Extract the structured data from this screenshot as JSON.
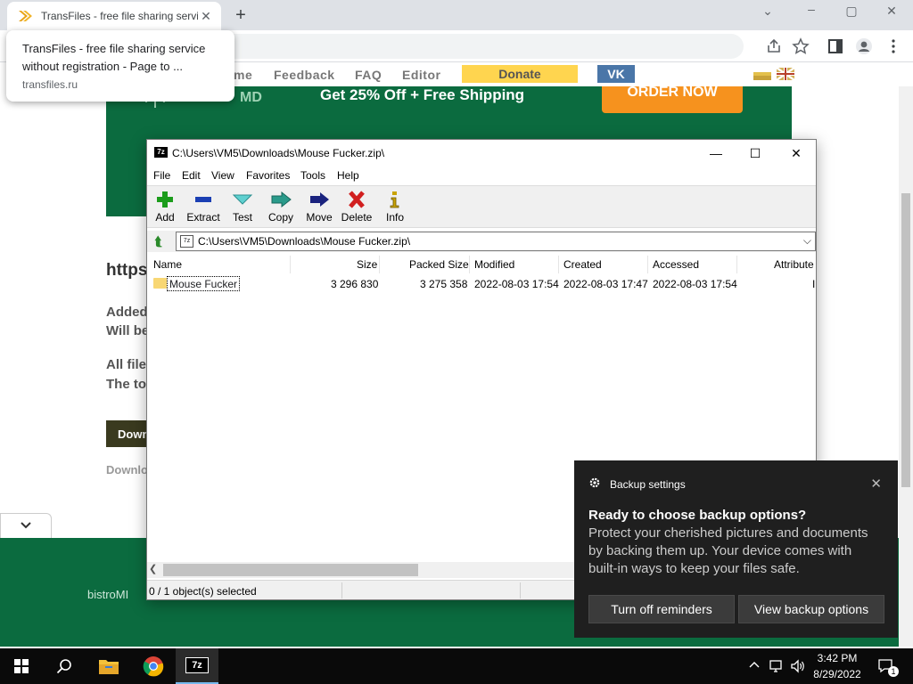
{
  "browser": {
    "tab_title": "TransFiles - free file sharing servi",
    "tab_close": "✕",
    "new_tab": "+",
    "hover_title": "TransFiles - free file sharing service without registration - Page to ...",
    "hover_url": "transfiles.ru",
    "minimize": "⌄",
    "maximize": "▢",
    "close": "✕"
  },
  "site": {
    "nav": [
      "me",
      "Feedback",
      "FAQ",
      "Editor"
    ],
    "donate": "Donate",
    "vk": "VK",
    "ad_logo": "MD",
    "ad_text": "Get 25% Off + Free Shipping",
    "ad_button": "ORDER NOW",
    "heading_fragment": "https",
    "line1": "Added",
    "line2": "Will be",
    "line3": "All file",
    "line4": "The to",
    "download_button": "Down",
    "download_note": "Downlo",
    "footer_brand": "bistroMI",
    "colors": {
      "banner": "#0b6b3f",
      "donate": "#ffd54f",
      "vk": "#4a76a8",
      "order": "#f6921e"
    }
  },
  "zip": {
    "title": "C:\\Users\\VM5\\Downloads\\Mouse Fucker.zip\\",
    "app_icon": "7z",
    "menu": [
      "File",
      "Edit",
      "View",
      "Favorites",
      "Tools",
      "Help"
    ],
    "tools": [
      {
        "label": "Add",
        "icon": "plus-icon"
      },
      {
        "label": "Extract",
        "icon": "minus-icon"
      },
      {
        "label": "Test",
        "icon": "check-icon"
      },
      {
        "label": "Copy",
        "icon": "copy-arrow-icon"
      },
      {
        "label": "Move",
        "icon": "move-arrow-icon"
      },
      {
        "label": "Delete",
        "icon": "x-icon"
      },
      {
        "label": "Info",
        "icon": "info-icon"
      }
    ],
    "address": "C:\\Users\\VM5\\Downloads\\Mouse Fucker.zip\\",
    "columns": [
      "Name",
      "Size",
      "Packed Size",
      "Modified",
      "Created",
      "Accessed",
      "Attribute"
    ],
    "rows": [
      {
        "name": "Mouse Fucker",
        "size": "3 296 830",
        "packed": "3 275 358",
        "modified": "2022-08-03 17:54",
        "created": "2022-08-03 17:47",
        "accessed": "2022-08-03 17:54",
        "attr": "I"
      }
    ],
    "status": "0 / 1 object(s) selected"
  },
  "toast": {
    "app": "Backup settings",
    "heading": "Ready to choose backup options?",
    "body": "Protect your cherished pictures and documents by backing them up. Your device comes with built-in ways to keep your files safe.",
    "btn_off": "Turn off reminders",
    "btn_view": "View backup options",
    "close": "✕"
  },
  "taskbar": {
    "time": "3:42 PM",
    "date": "8/29/2022",
    "zip_label": "7z",
    "notif_count": "1"
  }
}
